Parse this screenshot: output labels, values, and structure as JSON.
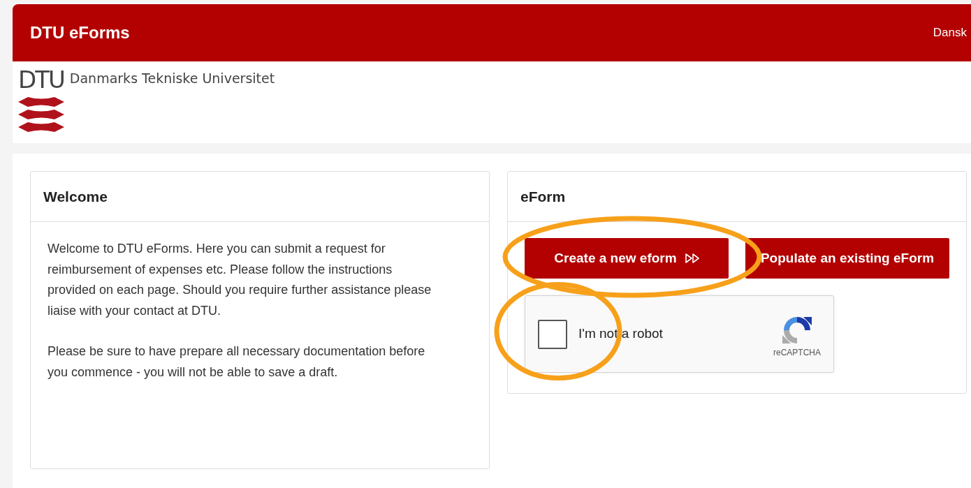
{
  "header": {
    "title": "DTU eForms",
    "language_link": "Dansk"
  },
  "logo": {
    "mark": "DTU",
    "name": "Danmarks Tekniske Universitet"
  },
  "welcome": {
    "title": "Welcome",
    "paragraphs": [
      "Welcome to DTU eForms. Here you can submit a request for reimbursement of expenses etc. Please follow the instructions provided on each page. Should you require further assistance please liaise with your contact at DTU.",
      "Please be sure to have prepare all necessary documentation before you commence - you will not be able to save a draft."
    ]
  },
  "eform": {
    "title": "eForm",
    "buttons": [
      {
        "label": "Create a new eform",
        "arrow": true,
        "highlighted": true
      },
      {
        "label": "Populate an existing eForm",
        "arrow": false,
        "highlighted": false
      }
    ],
    "captcha": {
      "label": "I'm not a robot",
      "checked": false,
      "brand": "reCAPTCHA",
      "highlighted": true
    }
  }
}
